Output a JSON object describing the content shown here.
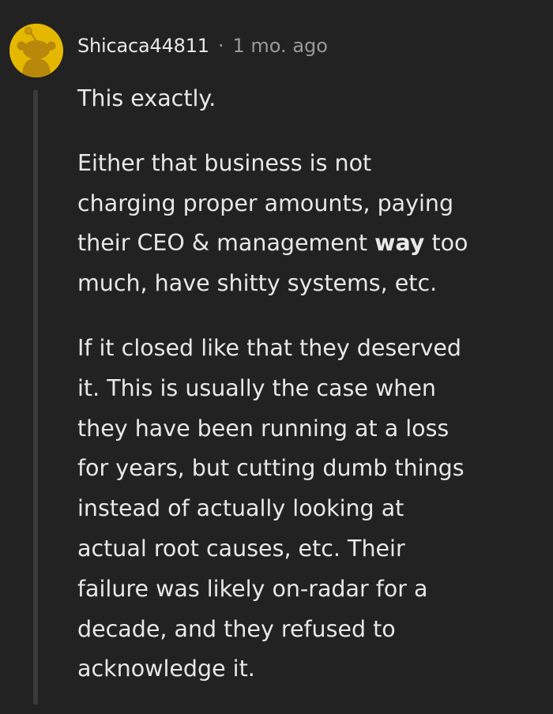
{
  "comment": {
    "username": "Shicaca44811",
    "separator": "·",
    "timestamp": "1 mo. ago",
    "avatar_icon": "snoo-avatar-icon",
    "avatar_color": "#e5b800",
    "paragraphs": [
      {
        "lines": [
          "This exactly."
        ]
      },
      {
        "lines": [
          "Either that business is not",
          "charging proper amounts, paying",
          {
            "before": "their CEO & management ",
            "bold": "way",
            "after": " too"
          },
          "much, have shitty systems, etc."
        ]
      },
      {
        "lines": [
          "If it closed like that they deserved",
          "it. This is usually the case when",
          "they have been running at a loss",
          "for years, but cutting dumb things",
          "instead of actually looking at",
          "actual root causes, etc. Their",
          "failure was likely on-radar for a",
          "decade, and they refused to",
          "acknowledge it."
        ]
      }
    ]
  }
}
